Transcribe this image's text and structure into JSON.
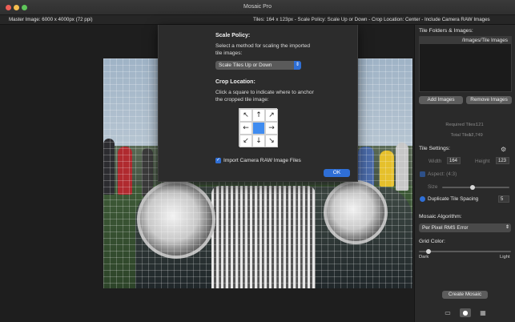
{
  "window": {
    "title": "Mosaic Pro"
  },
  "infobar": {
    "left": "Master Image: 6000 x 4000px (72 ppi)",
    "right": "Tiles: 164 x 123px  -  Scale Policy: Scale Up or Down  -  Crop Location: Center - Include Camera RAW Images"
  },
  "dialog": {
    "scale_heading": "Scale Policy:",
    "scale_desc": "Select a method for scaling the imported tile images:",
    "scale_value": "Scale Tiles Up or Down",
    "crop_heading": "Crop Location:",
    "crop_desc": "Click a square to indicate where to anchor the cropped tile image:",
    "crop_cells": [
      "↖",
      "↑",
      "↗",
      "←",
      "",
      "→",
      "↙",
      "↓",
      "↘"
    ],
    "crop_selected": "center",
    "raw_label": "Import Camera RAW Image Files",
    "raw_checked": true,
    "ok_label": "OK"
  },
  "panel": {
    "folders_heading": "Tile Folders & Images:",
    "folder_item": "/Images/Tile Images",
    "add_images": "Add Images",
    "remove_images": "Remove Images",
    "required_tiles_label": "Required Tiles:",
    "required_tiles": "121",
    "total_tiles_label": "Total Tiles:",
    "total_tiles": "12,749",
    "tile_settings_heading": "Tile Settings:",
    "width_label": "Width",
    "width_value": "164",
    "height_label": "Height",
    "height_value": "123",
    "aspect_label": "Aspect: (4:3)",
    "size_label": "Size",
    "size_level": 0.45,
    "duplicate_label": "Duplicate Tile Spacing",
    "duplicate_value": "5",
    "algorithm_heading": "Mosaic Algorithm:",
    "algorithm_value": "Per Pixel RMS Error",
    "grid_color_heading": "Grid Color:",
    "grid_level": 0.1,
    "dark_label": "Dark",
    "light_label": "Light",
    "create_label": "Create Mosaic",
    "bottom_icons": [
      "folder-icon",
      "gear-icon",
      "grid-icon"
    ]
  },
  "colors": {
    "accent": "#2f6fd6",
    "background": "#1e1e1e",
    "panel": "#2a2a2a"
  }
}
